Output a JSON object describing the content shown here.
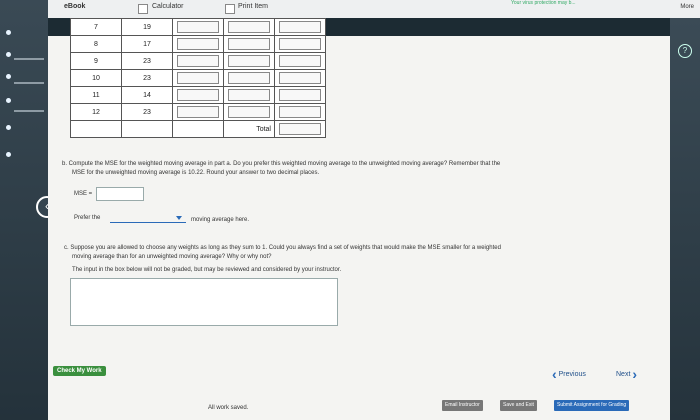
{
  "topbar": {
    "ebook": "eBook",
    "calculator": "Calculator",
    "print_item": "Print Item",
    "warning": "Your virus protection may b...",
    "more": "More"
  },
  "table": {
    "rows": [
      {
        "t": "7",
        "d": "19"
      },
      {
        "t": "8",
        "d": "17"
      },
      {
        "t": "9",
        "d": "23"
      },
      {
        "t": "10",
        "d": "23"
      },
      {
        "t": "11",
        "d": "14"
      },
      {
        "t": "12",
        "d": "23"
      }
    ],
    "total_label": "Total"
  },
  "part_b": {
    "text1": "b. Compute the MSE for the weighted moving average in part a. Do you prefer this weighted moving average to the unweighted moving average? Remember that the",
    "text2": "MSE for the unweighted moving average is 10.22. Round your answer to two decimal places.",
    "mse_label": "MSE =",
    "prefer_label": "Prefer the",
    "prefer_suffix": "moving average here."
  },
  "part_c": {
    "text1": "c. Suppose you are allowed to choose any weights as long as they sum to 1. Could you always find a set of weights that would make the MSE smaller for a weighted",
    "text2": "moving average than for an unweighted moving average? Why or why not?",
    "text3": "The input in the box below will not be graded, but may be reviewed and considered by your instructor."
  },
  "buttons": {
    "check": "Check My Work",
    "previous": "Previous",
    "next": "Next",
    "email": "Email Instructor",
    "save": "Save and Exit",
    "submit": "Submit Assignment for Grading"
  },
  "status": {
    "saved": "All work saved."
  },
  "icons": {
    "back": "chevron-left-icon",
    "help": "help-icon"
  }
}
